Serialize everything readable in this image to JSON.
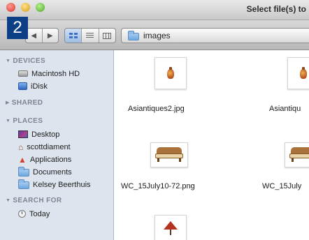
{
  "window": {
    "title": "Select file(s) to"
  },
  "badge": {
    "label": "2"
  },
  "toolbar": {
    "back_icon": "back-arrow-icon",
    "forward_icon": "forward-arrow-icon",
    "view_modes": [
      "icon-view",
      "list-view",
      "column-view"
    ],
    "active_view": "icon-view",
    "path_label": "images"
  },
  "sidebar": {
    "devices": {
      "header": "DEVICES",
      "items": [
        {
          "label": "Macintosh HD",
          "icon": "hard-drive-icon"
        },
        {
          "label": "iDisk",
          "icon": "idisk-icon"
        }
      ]
    },
    "shared": {
      "header": "SHARED"
    },
    "places": {
      "header": "PLACES",
      "items": [
        {
          "label": "Desktop",
          "icon": "desktop-icon"
        },
        {
          "label": "scottdiament",
          "icon": "home-icon"
        },
        {
          "label": "Applications",
          "icon": "applications-icon"
        },
        {
          "label": "Documents",
          "icon": "folder-icon"
        },
        {
          "label": "Kelsey Beerthuis",
          "icon": "folder-icon"
        }
      ]
    },
    "search_for": {
      "header": "SEARCH FOR",
      "items": [
        {
          "label": "Today",
          "icon": "clock-icon"
        }
      ]
    }
  },
  "files": [
    {
      "name": "Asiantiques2.jpg",
      "thumb": "vase"
    },
    {
      "name": "Asiantiqu",
      "thumb": "vase"
    },
    {
      "name": "WC_15July10-72.png",
      "thumb": "sofa"
    },
    {
      "name": "WC_15July",
      "thumb": "sofa"
    },
    {
      "name": "",
      "thumb": "lamp"
    }
  ]
}
